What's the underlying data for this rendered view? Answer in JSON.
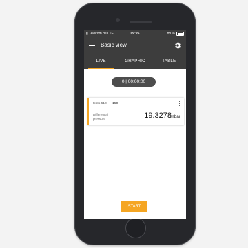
{
  "status_bar": {
    "carrier": "Telekom.de",
    "network": "LTE",
    "time": "09:26",
    "battery": "88 %"
  },
  "app_bar": {
    "title": "Basic view",
    "menu_icon": "hamburger-menu-icon",
    "settings_icon": "gear-icon"
  },
  "tabs": [
    {
      "label": "LIVE",
      "active": true
    },
    {
      "label": "GRAPHIC",
      "active": false
    },
    {
      "label": "TABLE",
      "active": false
    }
  ],
  "timer": "0 | 00:00:00",
  "measurement_card": {
    "probe": "testo 510i",
    "probe_id": "150",
    "label": "Differential pressure",
    "value": "19.3278",
    "unit": "mbar"
  },
  "start_button": "START",
  "colors": {
    "accent": "#f5a623",
    "app_bar": "#3d3d3d",
    "timer_pill": "#4d4d4d"
  }
}
